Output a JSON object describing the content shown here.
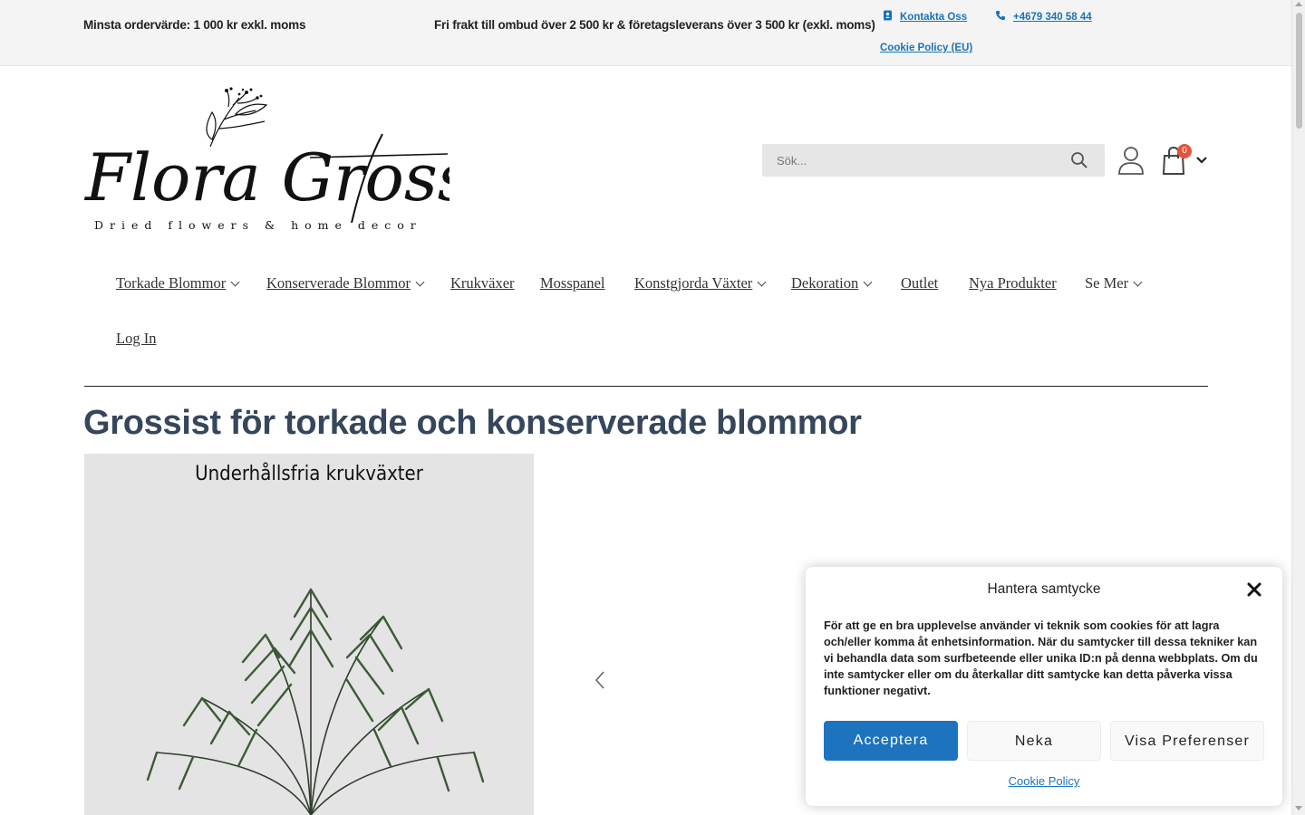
{
  "topbar": {
    "min_order": "Minsta ordervärde: 1 000 kr exkl. moms",
    "shipping": "Fri frakt till ombud över 2 500 kr & företagsleverans över 3 500 kr (exkl. moms)",
    "contact": "Kontakta Oss",
    "phone": "+4679 340 58 44",
    "cookie_policy": "Cookie Policy (EU)"
  },
  "logo": {
    "script_text": "Flora Grossist",
    "tagline": "Dried flowers & home decor"
  },
  "search": {
    "placeholder": "Sök..."
  },
  "cart": {
    "count": "0"
  },
  "nav": {
    "items": [
      {
        "label": "Torkade Blommor",
        "has_dropdown": true
      },
      {
        "label": "Konserverade Blommor",
        "has_dropdown": true
      },
      {
        "label": "Krukväxer",
        "has_dropdown": false
      },
      {
        "label": "Mosspanel",
        "has_dropdown": false
      },
      {
        "label": "Konstgjorda Växter",
        "has_dropdown": true
      },
      {
        "label": "Dekoration",
        "has_dropdown": true
      },
      {
        "label": "Outlet",
        "has_dropdown": false
      },
      {
        "label": "Nya Produkter",
        "has_dropdown": false
      },
      {
        "label": "Se Mer",
        "has_dropdown": true
      },
      {
        "label": "Log In",
        "has_dropdown": false
      }
    ]
  },
  "page": {
    "title": "Grossist för torkade och konserverade blommor"
  },
  "slider": {
    "caption": "Underhållsfria krukväxter"
  },
  "consent": {
    "title": "Hantera samtycke",
    "body": "För att ge en bra upplevelse använder vi teknik som cookies för att lagra och/eller komma åt enhetsinformation. När du samtycker till dessa tekniker kan vi behandla data som surfbeteende eller unika ID:n på denna webbplats. Om du inte samtycker eller om du återkallar ditt samtycke kan detta påverka vissa funktioner negativt.",
    "accept": "Acceptera",
    "deny": "Neka",
    "preferences": "Visa Preferenser",
    "cookie_policy": "Cookie Policy"
  },
  "colors": {
    "accent": "#1e73be",
    "title": "#36475c",
    "badge": "#e4533f"
  }
}
